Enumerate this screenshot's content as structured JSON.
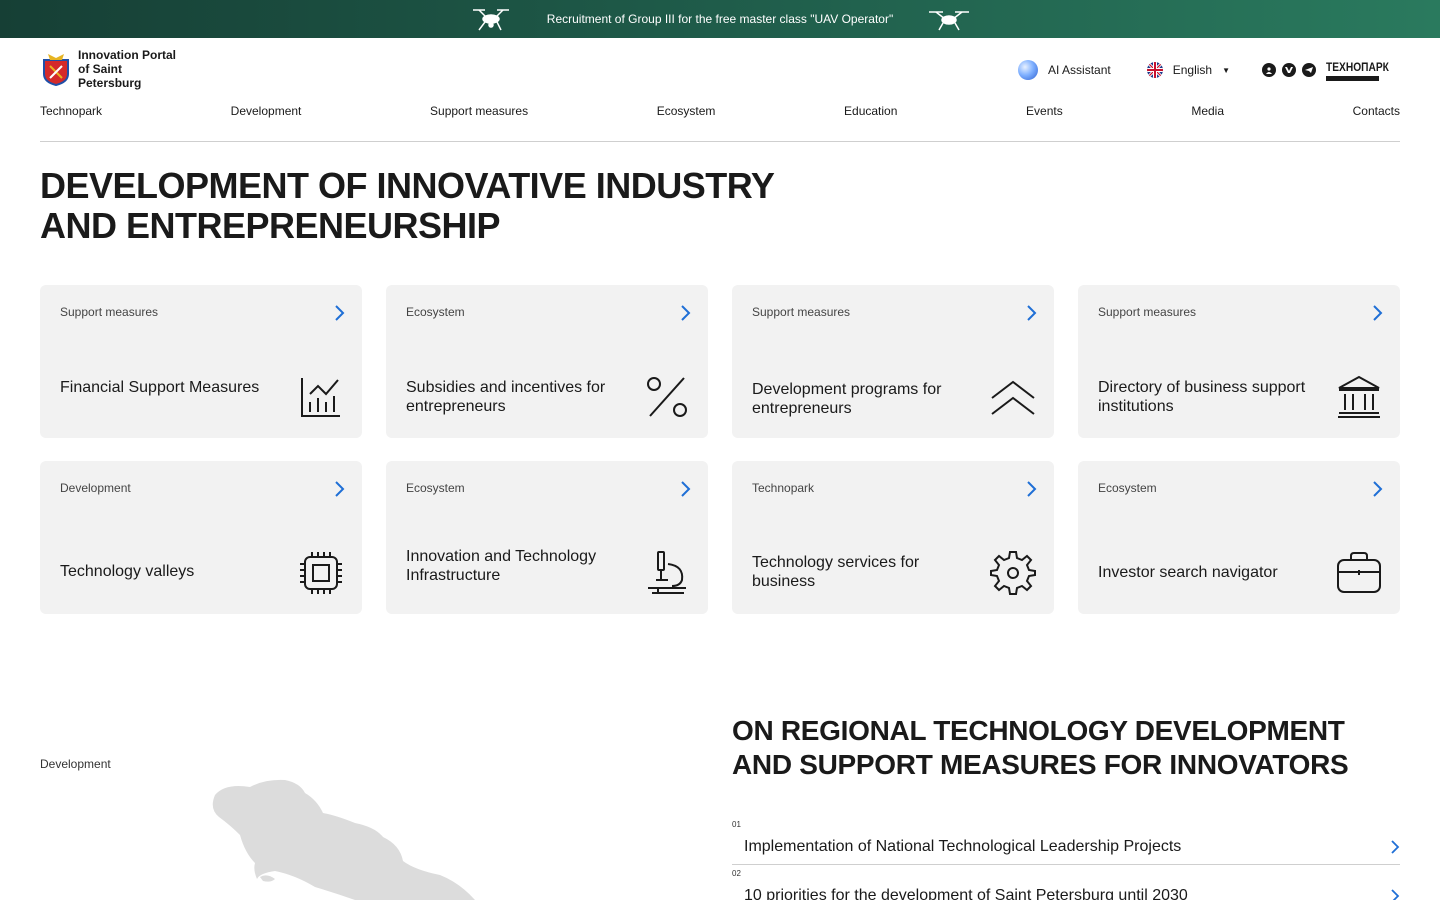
{
  "banner": {
    "text": "Recruitment of Group III for the free master class \"UAV Operator\""
  },
  "header": {
    "logo_text": "Innovation Portal of Saint Petersburg",
    "ai_label": "AI Assistant",
    "language": "English",
    "partner_logo": "ТЕХНОПАРК"
  },
  "nav": [
    "Technopark",
    "Development",
    "Support measures",
    "Ecosystem",
    "Education",
    "Events",
    "Media",
    "Contacts"
  ],
  "page_title": "Development of innovative industry and entrepreneurship",
  "cards": [
    {
      "category": "Support measures",
      "title": "Financial Support Measures",
      "icon": "chart-icon"
    },
    {
      "category": "Ecosystem",
      "title": "Subsidies and incentives for entrepreneurs",
      "icon": "percent-icon"
    },
    {
      "category": "Support measures",
      "title": "Development programs for entrepreneurs",
      "icon": "double-chevron-up-icon"
    },
    {
      "category": "Support measures",
      "title": "Directory of business support institutions",
      "icon": "institution-icon"
    },
    {
      "category": "Development",
      "title": "Technology valleys",
      "icon": "chip-icon"
    },
    {
      "category": "Ecosystem",
      "title": "Innovation and Technology Infrastructure",
      "icon": "microscope-icon"
    },
    {
      "category": "Technopark",
      "title": "Technology services for business",
      "icon": "gear-icon"
    },
    {
      "category": "Ecosystem",
      "title": "Investor search navigator",
      "icon": "briefcase-icon"
    }
  ],
  "lower": {
    "category": "Development",
    "title": "On regional technology development and support measures for innovators",
    "items": [
      {
        "num": "01",
        "label": "Implementation of National Technological Leadership Projects"
      },
      {
        "num": "02",
        "label": "10 priorities for the development of Saint Petersburg until 2030"
      }
    ]
  },
  "colors": {
    "banner_start": "#163f35",
    "banner_end": "#2a7a5e",
    "accent_arrow": "#1f6fd6",
    "card_bg": "#f2f2f2"
  }
}
